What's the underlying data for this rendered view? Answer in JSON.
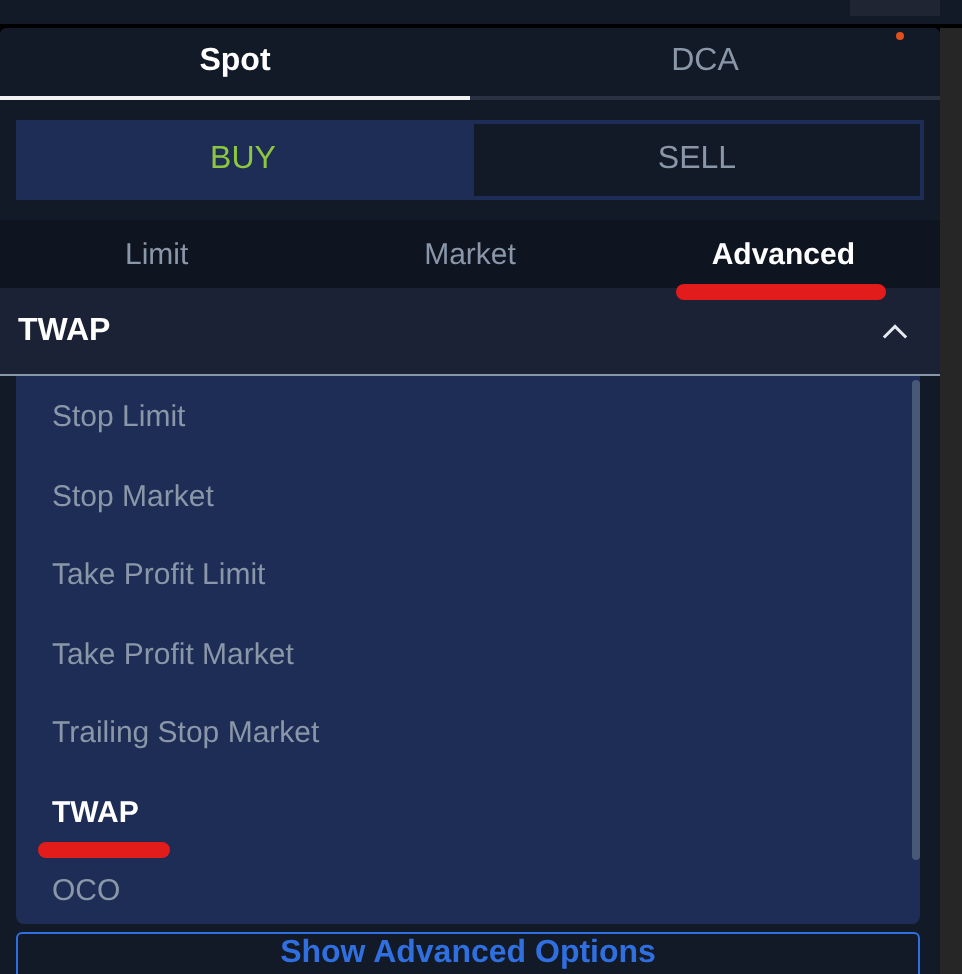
{
  "mode_tabs": [
    {
      "label": "Spot",
      "selected": true
    },
    {
      "label": "DCA",
      "selected": false
    }
  ],
  "side": [
    {
      "label": "BUY",
      "selected": true
    },
    {
      "label": "SELL",
      "selected": false
    }
  ],
  "order_tabs": [
    {
      "label": "Limit",
      "selected": false,
      "highlighted": false
    },
    {
      "label": "Market",
      "selected": false,
      "highlighted": false
    },
    {
      "label": "Advanced",
      "selected": true,
      "highlighted": true
    }
  ],
  "order_type_select": {
    "value": "TWAP",
    "expanded": true,
    "options": [
      {
        "label": "Stop Limit",
        "selected": false,
        "highlighted": false
      },
      {
        "label": "Stop Market",
        "selected": false,
        "highlighted": false
      },
      {
        "label": "Take Profit Limit",
        "selected": false,
        "highlighted": false
      },
      {
        "label": "Take Profit Market",
        "selected": false,
        "highlighted": false
      },
      {
        "label": "Trailing Stop Market",
        "selected": false,
        "highlighted": false
      },
      {
        "label": "TWAP",
        "selected": true,
        "highlighted": true
      },
      {
        "label": "OCO",
        "selected": false,
        "highlighted": false
      }
    ]
  },
  "advanced_button": "Show Advanced Options"
}
